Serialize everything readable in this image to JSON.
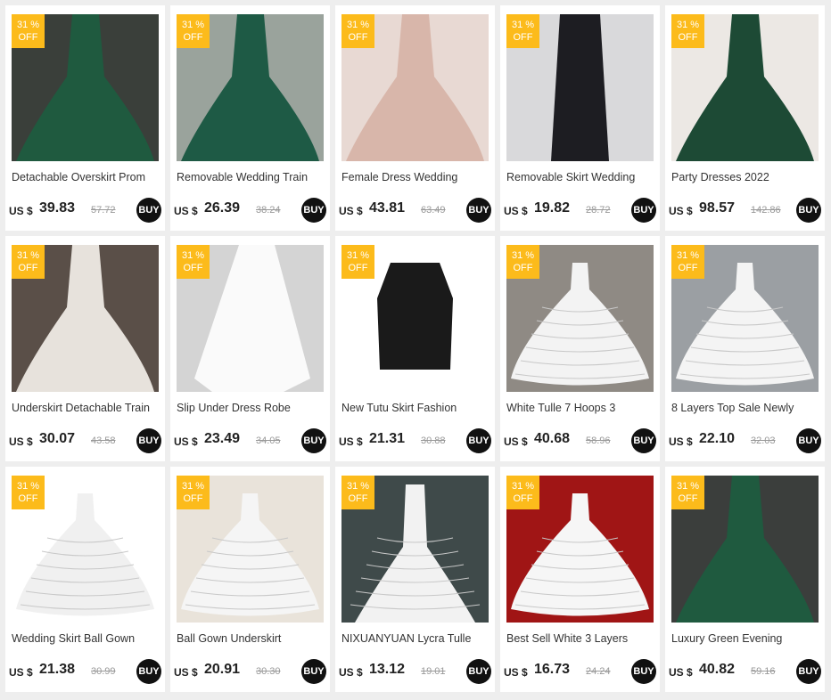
{
  "colors": {
    "badge": "#fcbb1b",
    "buy": "#111111",
    "background": "#eeeeee"
  },
  "products": [
    {
      "title": "Detachable Overskirt Prom",
      "currency": "US $",
      "price": "39.83",
      "old_price": "57.72",
      "discount": "31 %",
      "discount_label": "OFF",
      "buy": "BUY",
      "image": "green-sequin-gown",
      "bg": "#3a3f3a",
      "dress": "#1f5a3f"
    },
    {
      "title": "Removable Wedding Train",
      "currency": "US $",
      "price": "26.39",
      "old_price": "38.24",
      "discount": "31 %",
      "discount_label": "OFF",
      "buy": "BUY",
      "image": "emerald-gown",
      "bg": "#9aa39c",
      "dress": "#1e5a45"
    },
    {
      "title": "Female Dress Wedding",
      "currency": "US $",
      "price": "43.81",
      "old_price": "63.49",
      "discount": "31 %",
      "discount_label": "OFF",
      "buy": "BUY",
      "image": "blush-sequin-gown",
      "bg": "#e8d9d3",
      "dress": "#d8b6aa"
    },
    {
      "title": "Removable Skirt Wedding",
      "currency": "US $",
      "price": "19.82",
      "old_price": "28.72",
      "discount": "31 %",
      "discount_label": "OFF",
      "buy": "BUY",
      "image": "black-sheer-skirt",
      "bg": "#d9d9db",
      "dress": "#1d1d22"
    },
    {
      "title": "Party Dresses 2022",
      "currency": "US $",
      "price": "98.57",
      "old_price": "142.86",
      "discount": "31 %",
      "discount_label": "OFF",
      "buy": "BUY",
      "image": "green-sequin-gown",
      "bg": "#ece8e4",
      "dress": "#1d4a35"
    },
    {
      "title": "Underskirt Detachable Train",
      "currency": "US $",
      "price": "30.07",
      "old_price": "43.58",
      "discount": "31 %",
      "discount_label": "OFF",
      "buy": "BUY",
      "image": "white-tulle-gown",
      "bg": "#5a4f48",
      "dress": "#e7e2dc"
    },
    {
      "title": "Slip Under Dress Robe",
      "currency": "US $",
      "price": "23.49",
      "old_price": "34.05",
      "discount": "31 %",
      "discount_label": "OFF",
      "buy": "BUY",
      "image": "white-overskirt",
      "bg": "#d4d4d4",
      "dress": "#fafafa"
    },
    {
      "title": "New Tutu Skirt Fashion",
      "currency": "US $",
      "price": "21.31",
      "old_price": "30.88",
      "discount": "31 %",
      "discount_label": "OFF",
      "buy": "BUY",
      "image": "black-tutu-skirt",
      "bg": "#ffffff",
      "dress": "#1a1a1a"
    },
    {
      "title": "White Tulle 7 Hoops 3",
      "currency": "US $",
      "price": "40.68",
      "old_price": "58.96",
      "discount": "31 %",
      "discount_label": "OFF",
      "buy": "BUY",
      "image": "hoop-petticoat",
      "bg": "#8f8a84",
      "dress": "#f3f3f3"
    },
    {
      "title": "8 Layers Top Sale Newly",
      "currency": "US $",
      "price": "22.10",
      "old_price": "32.03",
      "discount": "31 %",
      "discount_label": "OFF",
      "buy": "BUY",
      "image": "tulle-petticoat",
      "bg": "#9b9fa3",
      "dress": "#f4f4f4"
    },
    {
      "title": "Wedding Skirt  Ball Gown",
      "currency": "US $",
      "price": "21.38",
      "old_price": "30.99",
      "discount": "31 %",
      "discount_label": "OFF",
      "buy": "BUY",
      "image": "hoop-crinoline",
      "bg": "#ffffff",
      "dress": "#f0f0f0"
    },
    {
      "title": "Ball Gown Underskirt",
      "currency": "US $",
      "price": "20.91",
      "old_price": "30.30",
      "discount": "31 %",
      "discount_label": "OFF",
      "buy": "BUY",
      "image": "hoop-crinoline",
      "bg": "#e9e3da",
      "dress": "#f5f5f5"
    },
    {
      "title": "NIXUANYUAN Lycra Tulle",
      "currency": "US $",
      "price": "13.12",
      "old_price": "19.01",
      "discount": "31 %",
      "discount_label": "OFF",
      "buy": "BUY",
      "image": "mermaid-petticoat",
      "bg": "#3f4a4a",
      "dress": "#f2f2f2"
    },
    {
      "title": "Best Sell White 3 Layers",
      "currency": "US $",
      "price": "16.73",
      "old_price": "24.24",
      "discount": "31 %",
      "discount_label": "OFF",
      "buy": "BUY",
      "image": "tulle-petticoat",
      "bg": "#a01515",
      "dress": "#f6f6f6"
    },
    {
      "title": "Luxury Green Evening",
      "currency": "US $",
      "price": "40.82",
      "old_price": "59.16",
      "discount": "31 %",
      "discount_label": "OFF",
      "buy": "BUY",
      "image": "green-sequin-gown",
      "bg": "#3b3e3c",
      "dress": "#1f5a3f"
    }
  ]
}
